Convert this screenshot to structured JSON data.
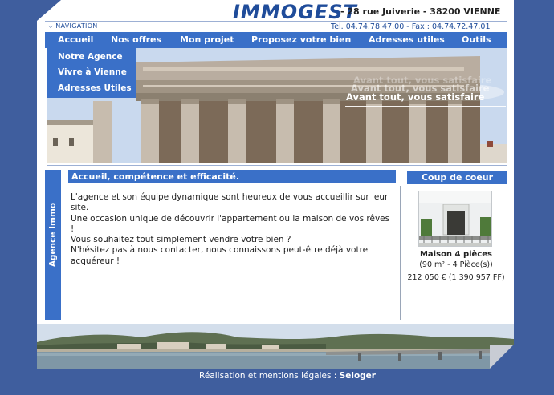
{
  "header": {
    "logo": "IMMOGEST",
    "address": "- 28 rue Juiverie - 38200 VIENNE",
    "nav_hint": "NAVIGATION",
    "contact": "Tel. 04.74.78.47.00 - Fax : 04.74.72.47.01"
  },
  "menu": {
    "items": [
      {
        "label": "Accueil"
      },
      {
        "label": "Nos offres"
      },
      {
        "label": "Mon projet"
      },
      {
        "label": "Proposez votre bien"
      },
      {
        "label": "Adresses utiles"
      },
      {
        "label": "Outils"
      }
    ],
    "submenu": [
      {
        "label": "Notre Agence"
      },
      {
        "label": "Vivre à Vienne"
      },
      {
        "label": "Adresses Utiles"
      }
    ]
  },
  "banner": {
    "slogan": "Avant tout, vous satisfaire"
  },
  "side_tab": {
    "label": "Agence Immo"
  },
  "main": {
    "heading": "Accueil, compétence et efficacité.",
    "paragraphs": [
      "L'agence et son équipe dynamique sont heureux de vous accueillir sur leur site.",
      "Une occasion unique de découvrir l'appartement ou la maison de vos rêves !",
      "Vous souhaitez tout simplement vendre votre bien ?",
      "N'hésitez pas à nous contacter, nous connaissons peut-être déjà votre acquéreur !"
    ]
  },
  "coup_de_coeur": {
    "heading": "Coup de coeur",
    "title": "Maison 4 pièces",
    "details": "(90 m² - 4 Pièce(s))",
    "price": "212 050 € (1 390 957 FF)"
  },
  "footer": {
    "text": "Réalisation et mentions légales :",
    "link": "Seloger"
  },
  "colors": {
    "background": "#3f5e9e",
    "accent": "#3a70c8",
    "logo": "#1f4c9a"
  }
}
